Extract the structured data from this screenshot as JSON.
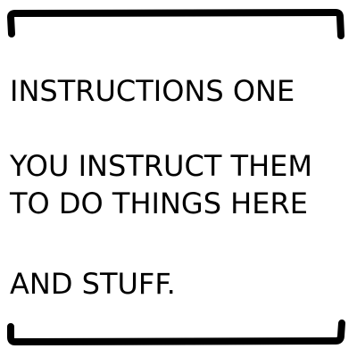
{
  "instructions": {
    "line1": "INSTRUCTIONS ONE",
    "line2": "YOU INSTRUCT THEM",
    "line3": "TO DO THINGS HERE",
    "line4": "AND STUFF."
  },
  "colors": {
    "background": "#ffffff",
    "ink": "#000000"
  }
}
